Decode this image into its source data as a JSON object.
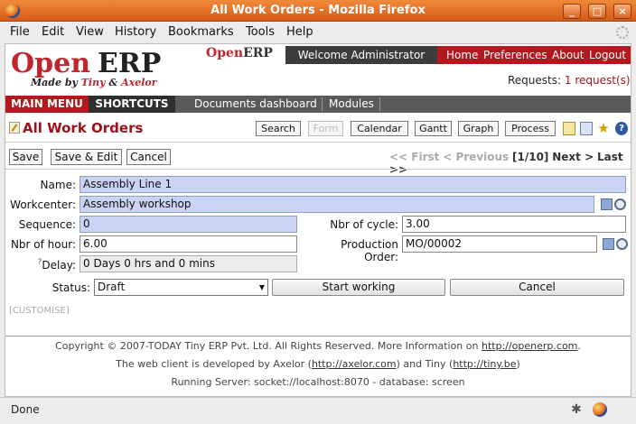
{
  "window": {
    "title": "All Work Orders - Mozilla Firefox",
    "controls": [
      "_",
      "□",
      "×"
    ]
  },
  "menubar": [
    "File",
    "Edit",
    "View",
    "History",
    "Bookmarks",
    "Tools",
    "Help"
  ],
  "header": {
    "logo_open": "Open",
    "logo_erp": "ERP",
    "logo_made_by": "Made by",
    "logo_tiny": "Tiny",
    "logo_amp": "&",
    "logo_axelor": "Axelor",
    "mini_open": "Open",
    "mini_erp": "ERP",
    "welcome": "Welcome Administrator",
    "nav": [
      "Home",
      "Preferences",
      "About",
      "Logout"
    ],
    "requests_label": "Requests:",
    "requests_count": "1 request(s)"
  },
  "mainmenu": {
    "main": "MAIN MENU",
    "shortcuts": "SHORTCUTS",
    "links": [
      "Documents dashboard",
      "Modules"
    ]
  },
  "page_title": "All Work Orders",
  "views": [
    "Search",
    "Form",
    "Calendar",
    "Gantt",
    "Graph",
    "Process"
  ],
  "actions": [
    "Save",
    "Save & Edit",
    "Cancel"
  ],
  "pager": {
    "first": "<< First",
    "previous": "< Previous",
    "current": "[1/10]",
    "next": "Next >",
    "last": "Last >>"
  },
  "form": {
    "name_label": "Name:",
    "name_value": "Assembly Line 1",
    "workcenter_label": "Workcenter:",
    "workcenter_value": "Assembly workshop",
    "sequence_label": "Sequence:",
    "sequence_value": "0",
    "cycle_label": "Nbr of cycle:",
    "cycle_value": "3.00",
    "hour_label": "Nbr of hour:",
    "hour_value": "6.00",
    "production_label": "Production Order:",
    "production_value": "MO/00002",
    "delay_help": "?",
    "delay_label": "Delay:",
    "delay_value": "0 Days 0 hrs  and 0 mins",
    "status_label": "Status:",
    "status_value": "Draft",
    "start_button": "Start working",
    "cancel_button": "Cancel"
  },
  "customise": "[CUSTOMISE]",
  "footer": {
    "line1": "Copyright © 2007-TODAY Tiny ERP Pvt. Ltd. All Rights Reserved. More Information on",
    "line1_link": "http://openerp.com",
    "line1_end": ".",
    "line2a": "The web client is developed by Axelor (",
    "line2_link1": "http://axelor.com",
    "line2b": ") and Tiny (",
    "line2_link2": "http://tiny.be",
    "line2c": ")",
    "line3": "Running Server: socket://localhost:8070 - database: screen"
  },
  "status": "Done",
  "colors": {
    "brand_red": "#b4171d",
    "title_bar": "#e2661b",
    "required_field": "#cbd3f5"
  }
}
